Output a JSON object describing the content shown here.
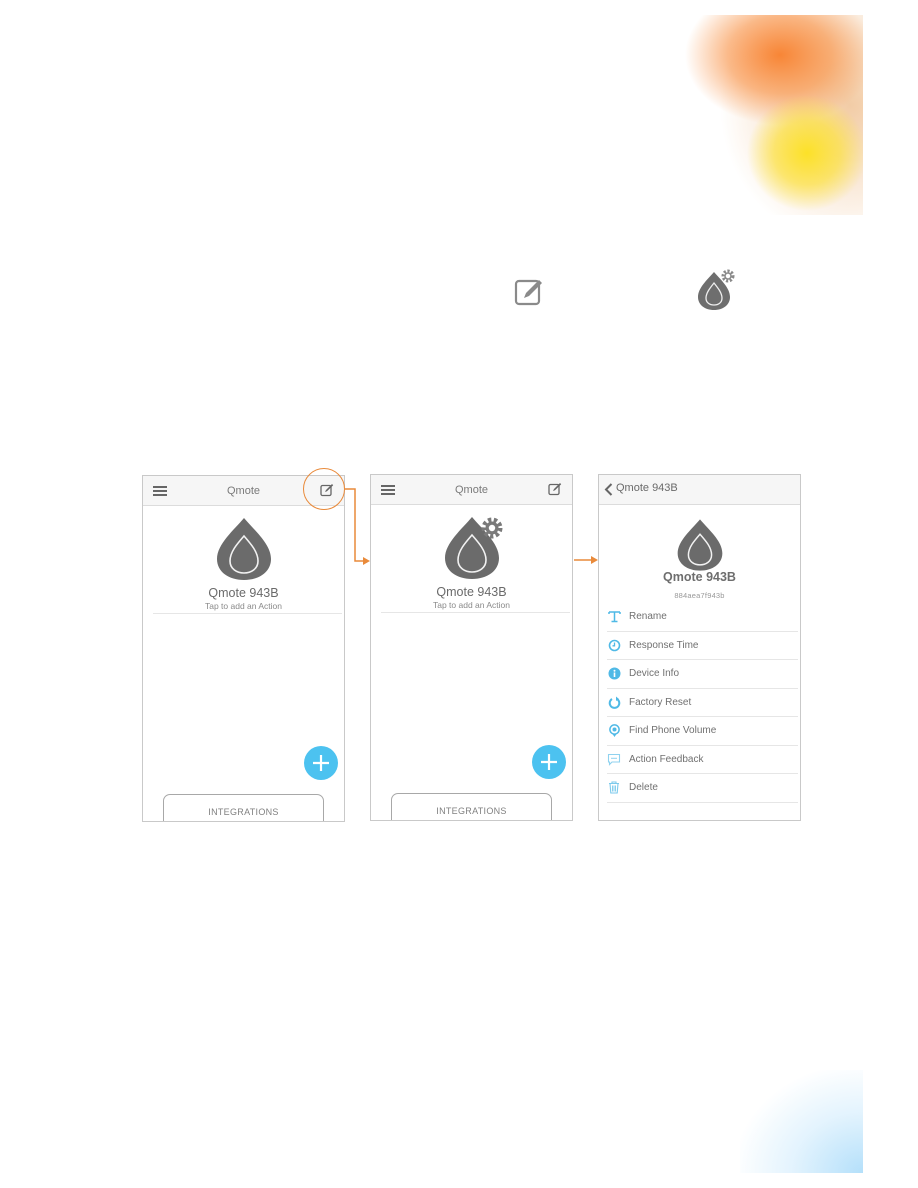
{
  "legend_icons": [
    {
      "icon": "edit-icon",
      "color": "#8a8a8a"
    },
    {
      "icon": "device-settings-icon",
      "color": "#6e6e6e"
    }
  ],
  "accent_colors": {
    "callout": "#e98a3a",
    "fab": "#4cc2f0",
    "menu_icon": "#4fb9e6"
  },
  "screens": [
    {
      "nav": {
        "title": "Qmote",
        "left_icon": "hamburger-menu-icon",
        "right_icon": "edit-icon"
      },
      "device": {
        "name": "Qmote 943B",
        "subtitle": "Tap to add an Action",
        "icon": "qmote-drop-icon"
      },
      "fab_icon": "plus-icon",
      "integrations_label": "INTEGRATIONS",
      "highlight": "edit-icon callout"
    },
    {
      "nav": {
        "title": "Qmote",
        "left_icon": "hamburger-menu-icon",
        "right_icon": "edit-icon"
      },
      "device": {
        "name": "Qmote 943B",
        "subtitle": "Tap to add an Action",
        "icon": "qmote-drop-gear-icon"
      },
      "fab_icon": "plus-icon",
      "integrations_label": "INTEGRATIONS"
    },
    {
      "nav": {
        "title": "Qmote 943B",
        "left_icon": "back-chevron-icon"
      },
      "device": {
        "name": "Qmote 943B",
        "id": "884aea7f943b",
        "icon": "qmote-drop-icon"
      },
      "menu": [
        {
          "label": "Rename",
          "icon": "text-icon"
        },
        {
          "label": "Response Time",
          "icon": "clock-icon"
        },
        {
          "label": "Device Info",
          "icon": "info-icon"
        },
        {
          "label": "Factory Reset",
          "icon": "reset-icon"
        },
        {
          "label": "Find Phone Volume",
          "icon": "location-pin-icon"
        },
        {
          "label": "Action Feedback",
          "icon": "chat-bubble-icon"
        },
        {
          "label": "Delete",
          "icon": "trash-icon"
        }
      ]
    }
  ]
}
